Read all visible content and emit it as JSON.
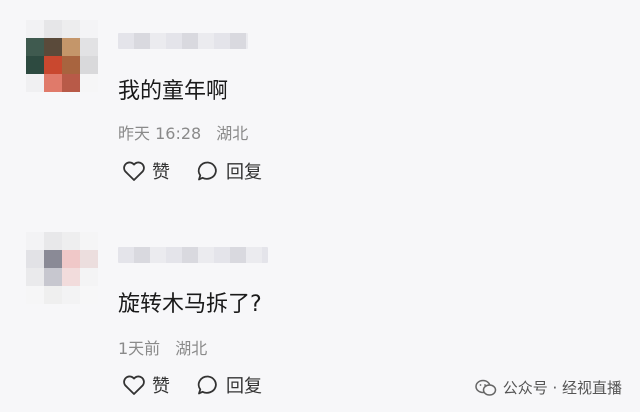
{
  "comments": [
    {
      "text": "我的童年啊",
      "time": "昨天 16:28",
      "location": "湖北",
      "like_label": "赞",
      "reply_label": "回复"
    },
    {
      "text": "旋转木马拆了?",
      "time": "1天前",
      "location": "湖北",
      "like_label": "赞",
      "reply_label": "回复"
    }
  ],
  "watermark": {
    "text": "公众号 · 经视直播"
  }
}
